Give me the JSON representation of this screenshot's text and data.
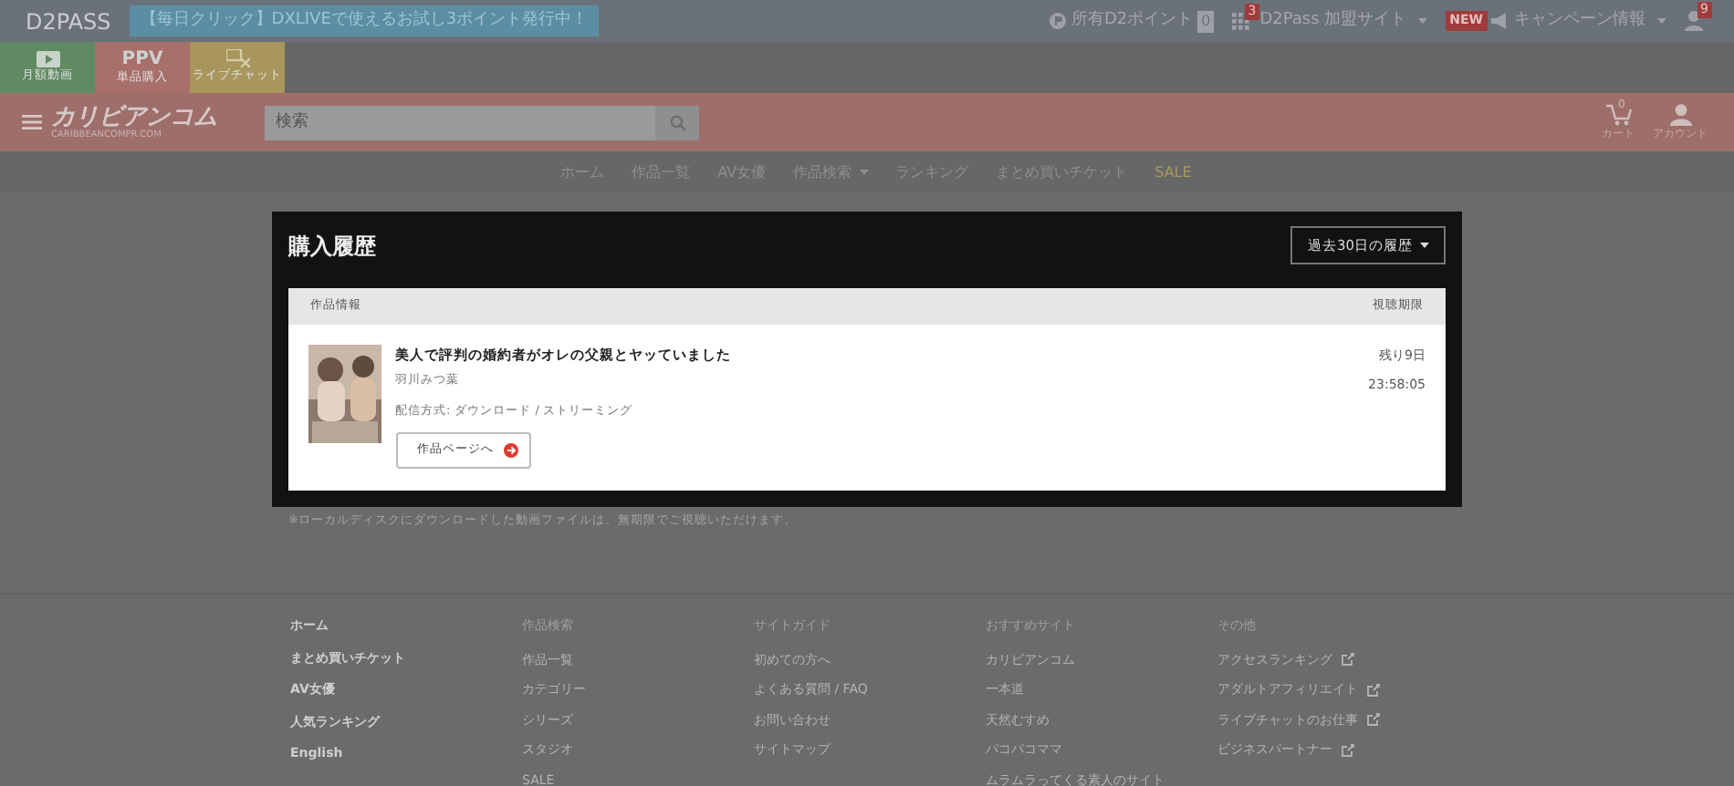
{
  "top_bar": {
    "logo": "D2PASS",
    "promo": "【毎日クリック】DXLIVEで使えるお試し3ポイント発行中！",
    "points_label": "所有D2ポイント",
    "points_value": "0",
    "sites_badge": "3",
    "sites_label": "D2Pass 加盟サイト",
    "new_badge": "NEW",
    "campaign_label": "キャンペーン情報",
    "user_badge": "9"
  },
  "service_tabs": [
    {
      "kind": "video",
      "label": "月額動画",
      "color": "#5f8a62"
    },
    {
      "kind": "ppv",
      "title": "PPV",
      "label": "単品購入",
      "color": "#a8706b"
    },
    {
      "kind": "live",
      "label": "ライブチャット",
      "color": "#a8965c"
    }
  ],
  "header": {
    "logo": "カリビアンコム",
    "logo_sub": "CARIBBEANCOMPR.COM",
    "search": {
      "placeholder": "検索"
    },
    "cart_count": "0",
    "cart_label": "カート",
    "account_label": "アカウント"
  },
  "nav": [
    {
      "label": "ホーム",
      "dropdown": false,
      "highlight": false
    },
    {
      "label": "作品一覧",
      "dropdown": false,
      "highlight": false
    },
    {
      "label": "AV女優",
      "dropdown": false,
      "highlight": false
    },
    {
      "label": "作品検索",
      "dropdown": true,
      "highlight": false
    },
    {
      "label": "ランキング",
      "dropdown": false,
      "highlight": false
    },
    {
      "label": "まとめ買いチケット",
      "dropdown": false,
      "highlight": false
    },
    {
      "label": "SALE",
      "dropdown": false,
      "highlight": true
    }
  ],
  "panel": {
    "title": "購入履歴",
    "period": "過去30日の履歴",
    "columns": [
      "作品情報",
      "視聴期限"
    ],
    "items": [
      {
        "title": "美人で評判の婚約者がオレの父親とヤッていました",
        "actress": "羽川みつ葉",
        "delivery_label": "配信方式:",
        "delivery": "ダウンロード / ストリーミング",
        "button": "作品ページへ",
        "remaining": "残り9日",
        "time": "23:58:05"
      }
    ]
  },
  "note": "※ローカルディスクにダウンロードした動画ファイルは、無期限でご視聴いただけます。",
  "footer": [
    {
      "kind": "main",
      "links": [
        {
          "label": "ホーム",
          "external": false
        },
        {
          "label": "まとめ買いチケット",
          "external": false
        },
        {
          "label": "AV女優",
          "external": false
        },
        {
          "label": "人気ランキング",
          "external": false
        },
        {
          "label": "English",
          "external": false
        }
      ]
    },
    {
      "kind": "list",
      "heading": "作品検索",
      "links": [
        {
          "label": "作品一覧",
          "external": false
        },
        {
          "label": "カテゴリー",
          "external": false
        },
        {
          "label": "シリーズ",
          "external": false
        },
        {
          "label": "スタジオ",
          "external": false
        },
        {
          "label": "SALE",
          "external": false
        }
      ]
    },
    {
      "kind": "list",
      "heading": "サイトガイド",
      "links": [
        {
          "label": "初めての方へ",
          "external": false
        },
        {
          "label": "よくある質問 / FAQ",
          "external": false
        },
        {
          "label": "お問い合わせ",
          "external": false
        },
        {
          "label": "サイトマップ",
          "external": false
        }
      ]
    },
    {
      "kind": "list",
      "heading": "おすすめサイト",
      "links": [
        {
          "label": "カリビアンコム",
          "external": false
        },
        {
          "label": "一本道",
          "external": false
        },
        {
          "label": "天然むすめ",
          "external": false
        },
        {
          "label": "パコパコママ",
          "external": false
        },
        {
          "label": "ムラムラってくる素人のサイト",
          "external": false
        }
      ]
    },
    {
      "kind": "list",
      "heading": "その他",
      "links": [
        {
          "label": "アクセスランキング",
          "external": true
        },
        {
          "label": "アダルトアフィリエイト",
          "external": true
        },
        {
          "label": "ライブチャットのお仕事",
          "external": true
        },
        {
          "label": "ビジネスパートナー",
          "external": true
        }
      ]
    }
  ]
}
